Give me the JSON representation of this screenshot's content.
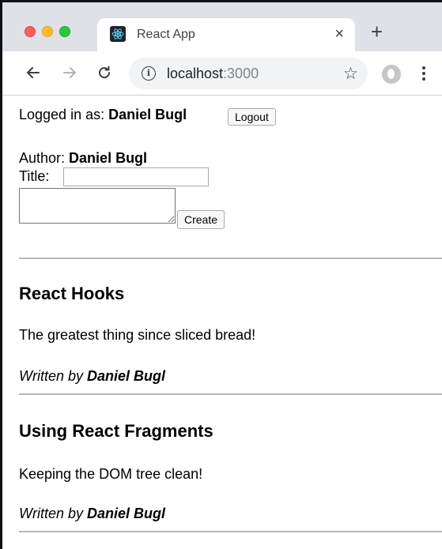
{
  "browser": {
    "tab": {
      "title": "React App",
      "close_glyph": "×"
    },
    "new_tab_glyph": "+",
    "nav": {
      "back_glyph": "←",
      "forward_glyph": "→",
      "reload_glyph": "C"
    },
    "omnibox": {
      "info_glyph": "i",
      "host": "localhost",
      "port": ":3000"
    },
    "bookmark_glyph": "☆"
  },
  "app": {
    "login": {
      "prefix": "Logged in as: ",
      "user": "Daniel Bugl",
      "logout_label": "Logout"
    },
    "create_form": {
      "author_prefix": "Author: ",
      "author_name": "Daniel Bugl",
      "title_label": "Title:",
      "title_value": "",
      "content_value": "",
      "create_label": "Create"
    },
    "posts": [
      {
        "title": "React Hooks",
        "content": "The greatest thing since sliced bread!",
        "by_prefix": "Written by ",
        "author": "Daniel Bugl"
      },
      {
        "title": "Using React Fragments",
        "content": "Keeping the DOM tree clean!",
        "by_prefix": "Written by ",
        "author": "Daniel Bugl"
      }
    ]
  },
  "colors": {
    "tabstrip": "#dee1e6",
    "close_red": "#ff5f57",
    "minimize_yellow": "#febc2e",
    "zoom_green": "#28c840",
    "port_gray": "#80868b",
    "divider": "#b8b8b8"
  },
  "icons": [
    "close-window-icon",
    "minimize-window-icon",
    "zoom-window-icon",
    "react-favicon-icon",
    "tab-close-icon",
    "new-tab-icon",
    "back-arrow-icon",
    "forward-arrow-icon",
    "reload-icon",
    "info-icon",
    "bookmark-star-icon",
    "profile-avatar-icon",
    "more-menu-icon"
  ]
}
